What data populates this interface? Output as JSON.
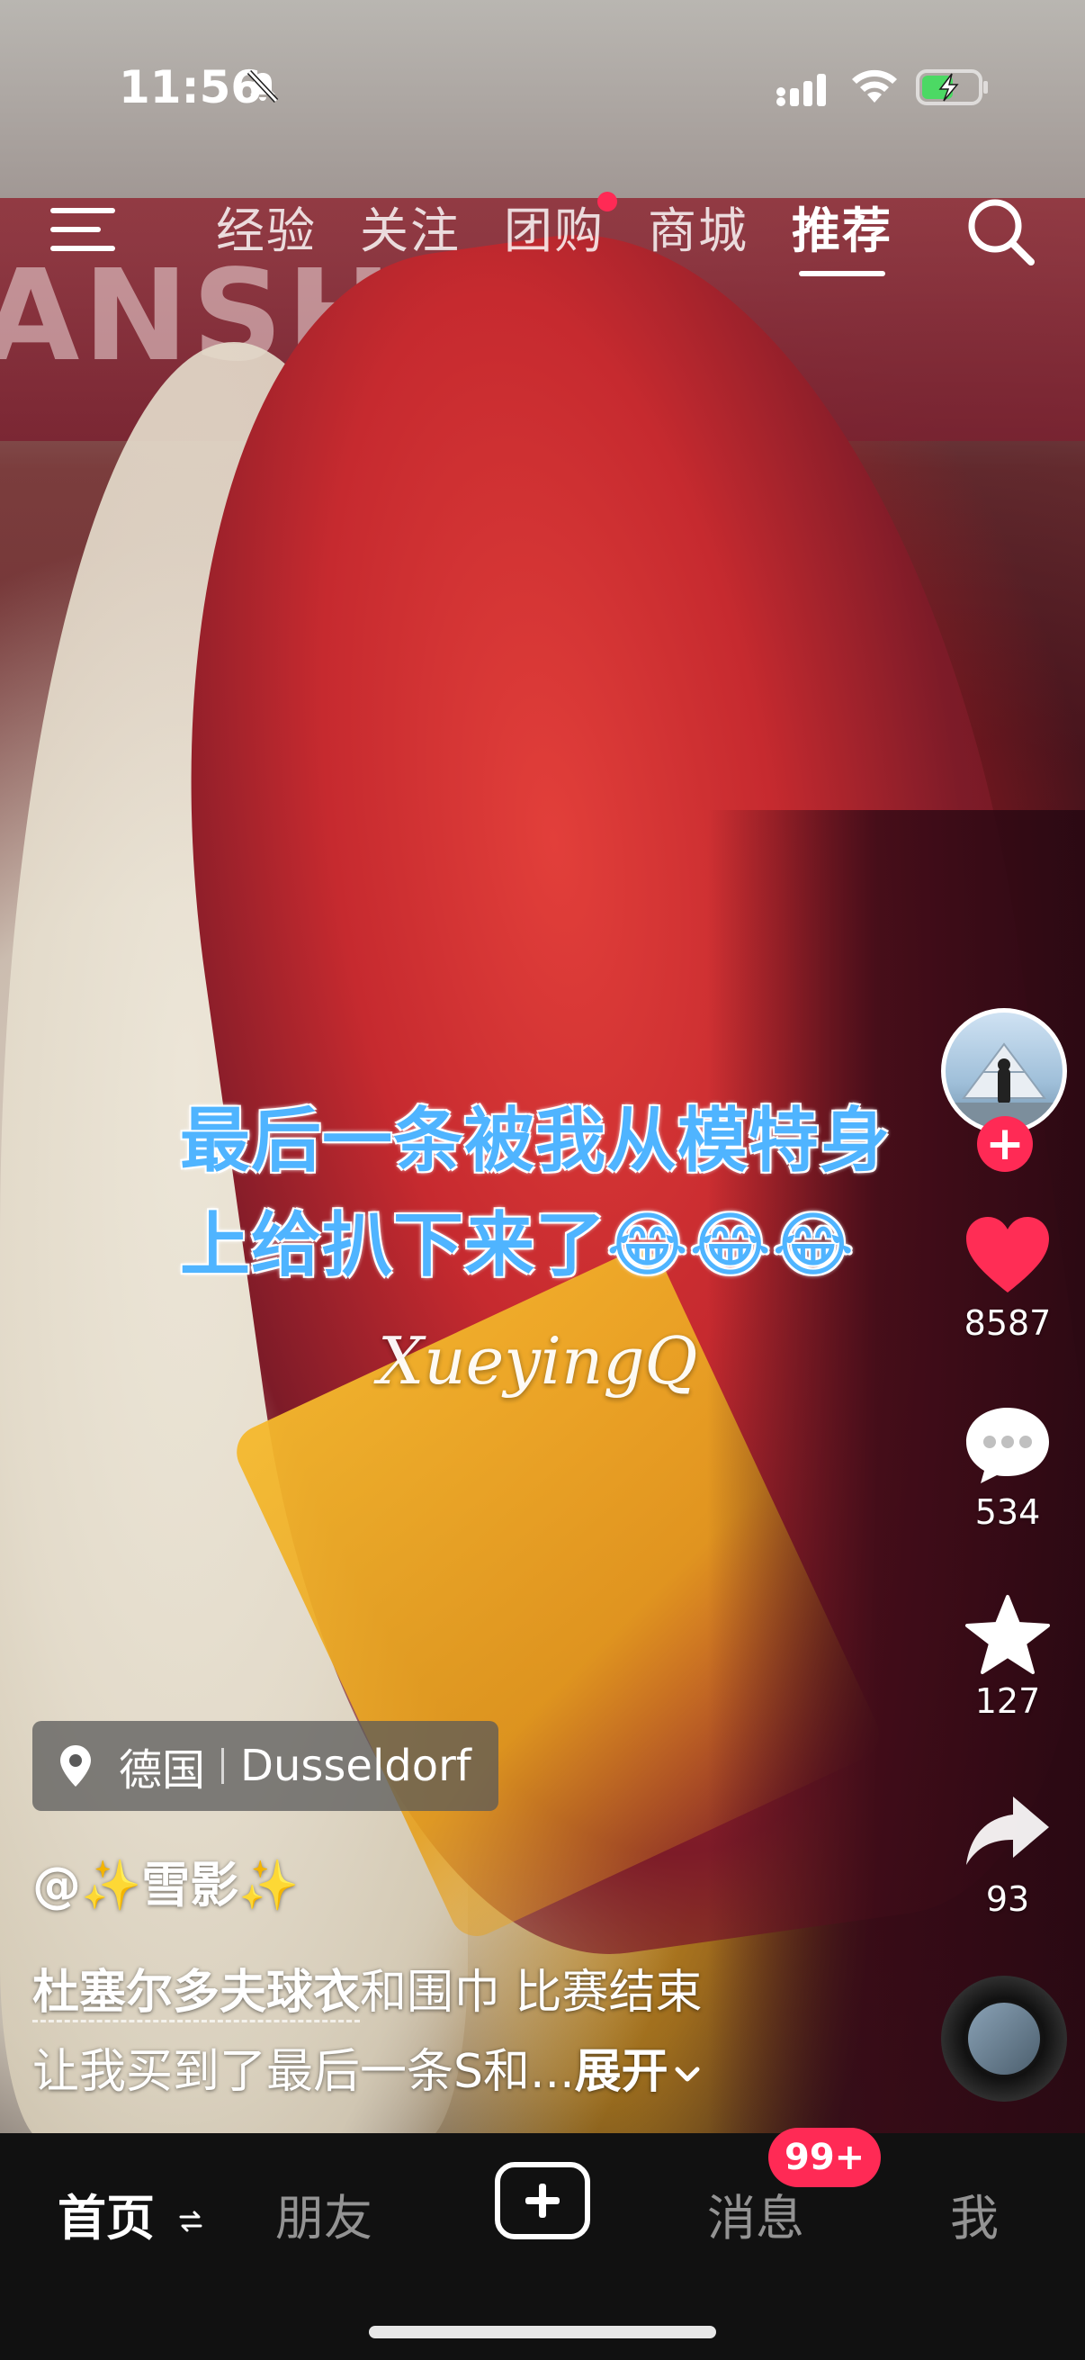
{
  "status_bar": {
    "time": "11:56"
  },
  "top_nav": {
    "tabs": [
      {
        "label": "经验",
        "active": false,
        "dot": false
      },
      {
        "label": "关注",
        "active": false,
        "dot": false
      },
      {
        "label": "团购",
        "active": false,
        "dot": true
      },
      {
        "label": "商城",
        "active": false,
        "dot": false
      },
      {
        "label": "推荐",
        "active": true,
        "dot": false
      }
    ]
  },
  "video": {
    "caption_line1": "最后一条被我从模特身",
    "caption_line2": "上给扒下来了😂😂😂",
    "watermark": "XueyingQ",
    "banner_text": "ANSHOP"
  },
  "rail": {
    "likes": "8587",
    "comments": "534",
    "favorites": "127",
    "shares": "93"
  },
  "post": {
    "location_country": "德国",
    "location_city": "Dusseldorf",
    "username": "@✨雪影✨",
    "desc_link": "杜塞尔多夫球衣",
    "desc_line1_rest": "和围巾 比赛结束",
    "desc_line2": "让我买到了最后一条S和...",
    "expand_label": "展开"
  },
  "tab_bar": {
    "home": "首页",
    "friends": "朋友",
    "messages": "消息",
    "messages_badge": "99+",
    "me": "我"
  },
  "colors": {
    "accent": "#ff2a55",
    "caption_blue": "#4fb4ff",
    "tab_bar_bg": "#111111"
  }
}
